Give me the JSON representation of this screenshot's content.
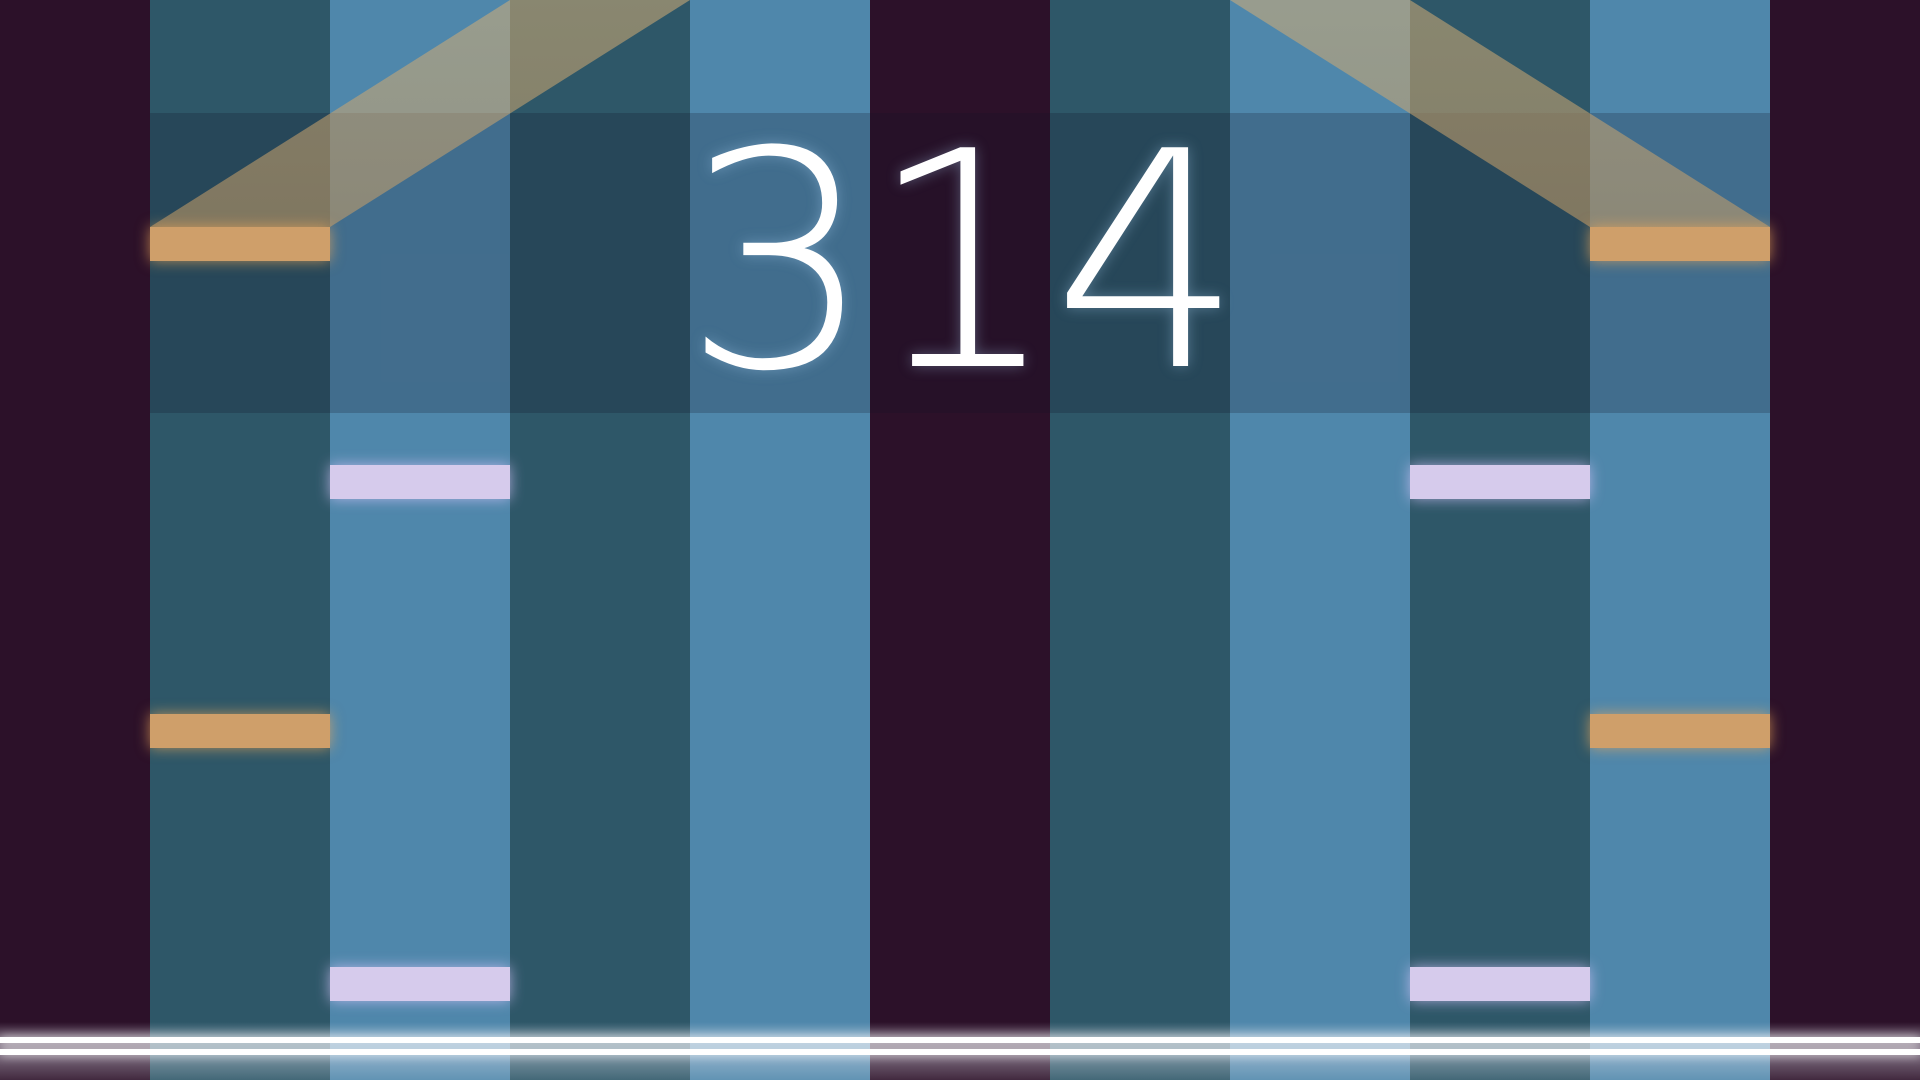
{
  "game": {
    "score": "314"
  },
  "colors": {
    "background": "#2c1129",
    "lane_teal": "#2e5768",
    "lane_blue": "#4f87ab",
    "tile_orange": "#cf9f6a",
    "tile_lilac": "#d6cbec",
    "beam": "#d4ae76",
    "hit_line": "#ffffff"
  },
  "lanes": [
    "plum",
    "teal",
    "blue",
    "teal",
    "blue",
    "plum",
    "teal",
    "blue",
    "teal",
    "blue",
    "plum"
  ],
  "tiles": [
    {
      "lane": "teal-left",
      "color": "orange"
    },
    {
      "lane": "teal-left",
      "color": "orange"
    },
    {
      "lane": "blue-left",
      "color": "lilac"
    },
    {
      "lane": "blue-left",
      "color": "lilac"
    },
    {
      "lane": "teal-right",
      "color": "lilac"
    },
    {
      "lane": "teal-right",
      "color": "lilac"
    },
    {
      "lane": "blue-right",
      "color": "orange"
    },
    {
      "lane": "blue-right",
      "color": "orange"
    }
  ]
}
